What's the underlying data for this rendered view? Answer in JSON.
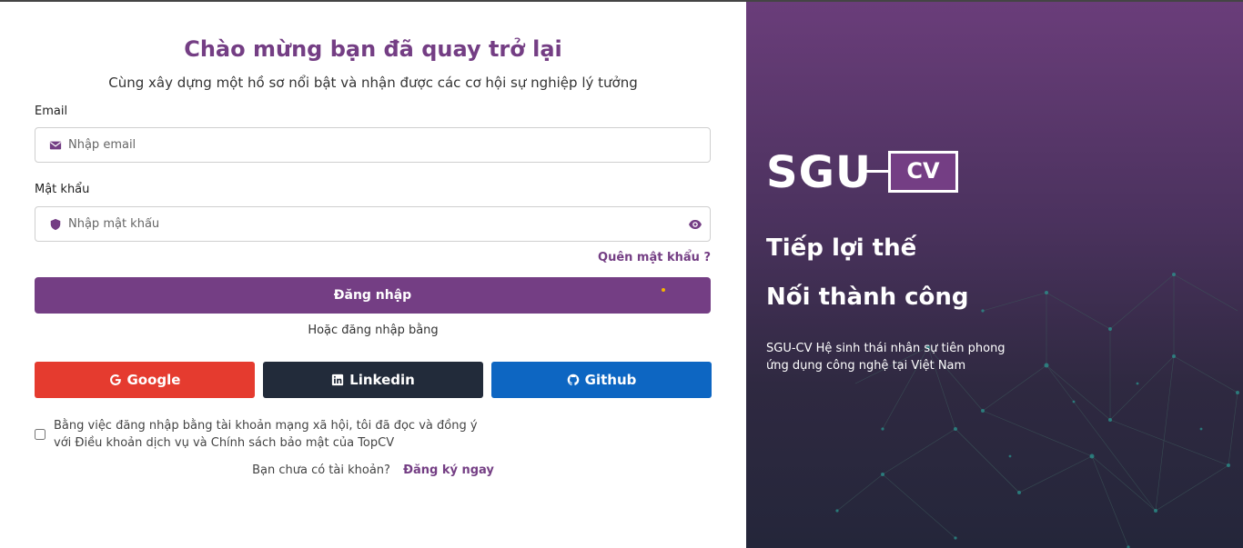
{
  "login": {
    "title": "Chào mừng bạn đã quay trở lại",
    "subtitle": "Cùng xây dựng một hồ sơ nổi bật và nhận được các cơ hội sự nghiệp lý tưởng",
    "email_label": "Email",
    "email_placeholder": "Nhập email",
    "password_label": "Mật khẩu",
    "password_placeholder": "Nhập mật khẩu",
    "forgot_label": "Quên mật khẩu ?",
    "login_button": "Đăng nhập",
    "or_text": "Hoặc đăng nhập bằng",
    "social": {
      "google": "Google",
      "linkedin": "Linkedin",
      "github": "Github"
    },
    "terms_text": "Bằng việc đăng nhập bằng tài khoản mạng xã hội, tôi đã đọc và đồng ý với Điều khoản dịch vụ và Chính sách bảo mật của TopCV",
    "signup_prompt": "Bạn chưa có tài khoản?",
    "signup_link": "Đăng ký ngay"
  },
  "brand": {
    "logo_sgu": "SGU",
    "logo_cv": "CV",
    "slogan_line1": "Tiếp lợi thế",
    "slogan_line2": "Nối thành công",
    "description": "SGU-CV Hệ sinh thái nhân sự tiên phong ứng dụng công nghệ tại Việt Nam"
  },
  "colors": {
    "primary": "#743e84",
    "google": "#e53b2f",
    "linkedin": "#222b3a",
    "github": "#0d66c2"
  },
  "icons": {
    "email": "envelope-icon",
    "password": "shield-icon",
    "toggle": "eye-icon",
    "google": "google-icon",
    "linkedin": "linkedin-icon",
    "github": "github-icon"
  }
}
